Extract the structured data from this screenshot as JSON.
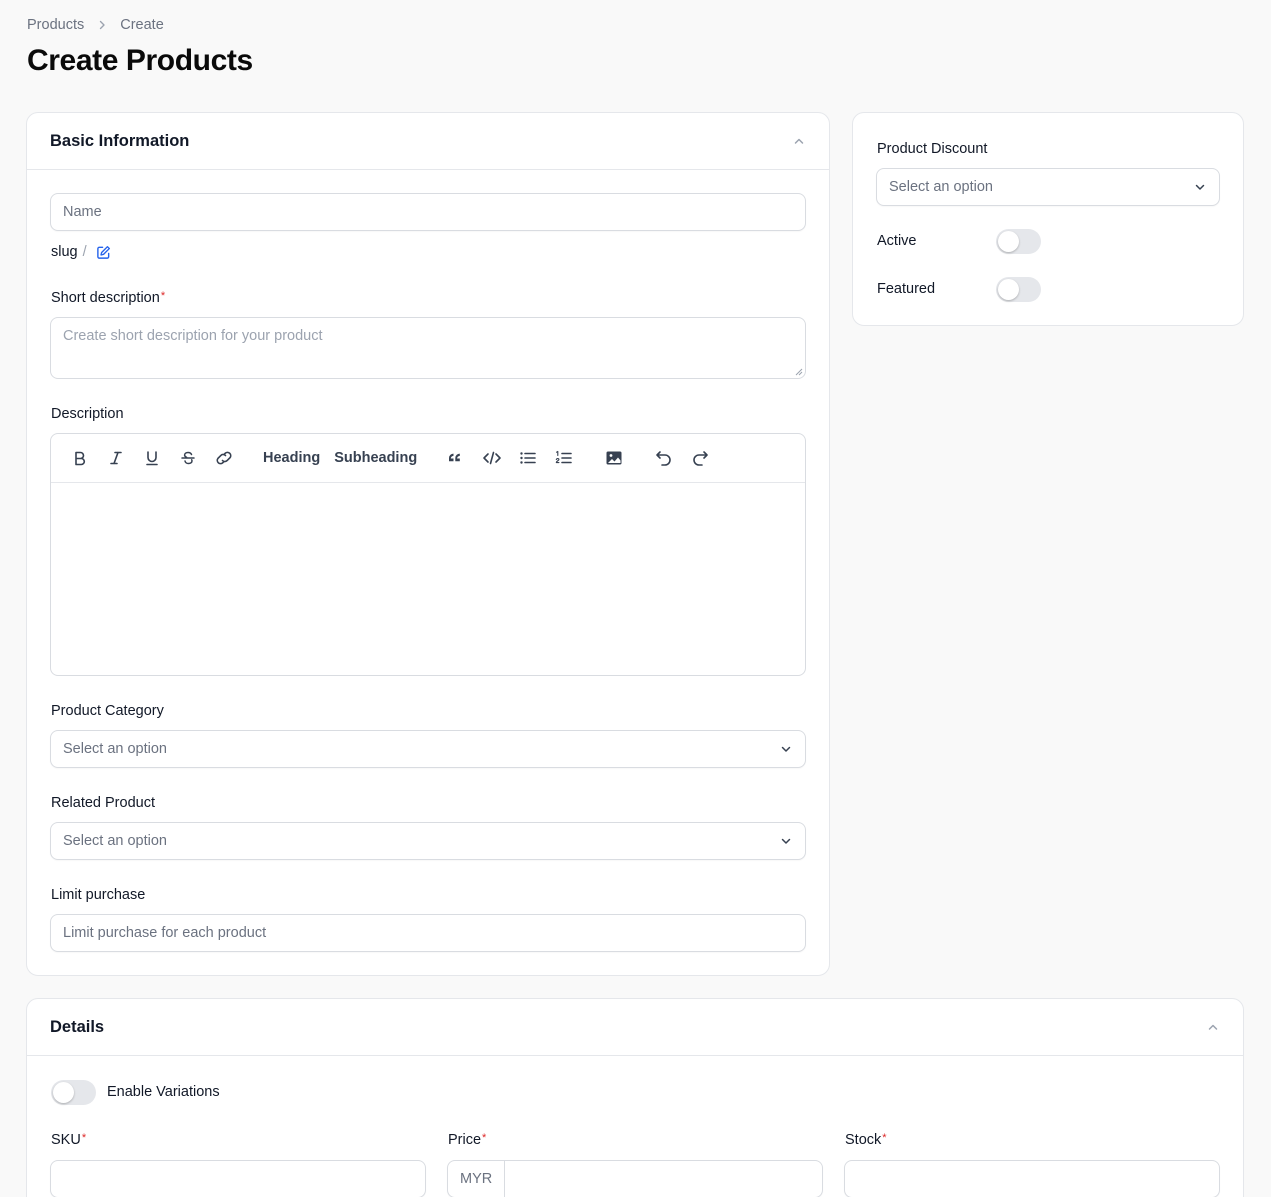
{
  "breadcrumb": {
    "items": [
      "Products",
      "Create"
    ]
  },
  "page": {
    "title": "Create Products"
  },
  "basic": {
    "title": "Basic Information",
    "name_placeholder": "Name",
    "slug_label": "slug",
    "slug_sep": "/",
    "short_desc": {
      "label": "Short description",
      "placeholder": "Create short description for your product"
    },
    "description": {
      "label": "Description"
    },
    "toolbar": {
      "heading": "Heading",
      "subheading": "Subheading"
    },
    "category": {
      "label": "Product Category",
      "placeholder": "Select an option"
    },
    "related": {
      "label": "Related Product",
      "placeholder": "Select an option"
    },
    "limit": {
      "label": "Limit purchase",
      "placeholder": "Limit purchase for each product"
    }
  },
  "side": {
    "discount": {
      "label": "Product Discount",
      "placeholder": "Select an option"
    },
    "active_label": "Active",
    "featured_label": "Featured",
    "active": false,
    "featured": false
  },
  "details": {
    "title": "Details",
    "variations_label": "Enable Variations",
    "sku_label": "SKU",
    "price_label": "Price",
    "currency": "MYR",
    "stock_label": "Stock",
    "required_mark": "*"
  },
  "colors": {
    "accent": "#2563eb",
    "required": "#dc2626",
    "toggle_off": "#e5e7eb"
  }
}
